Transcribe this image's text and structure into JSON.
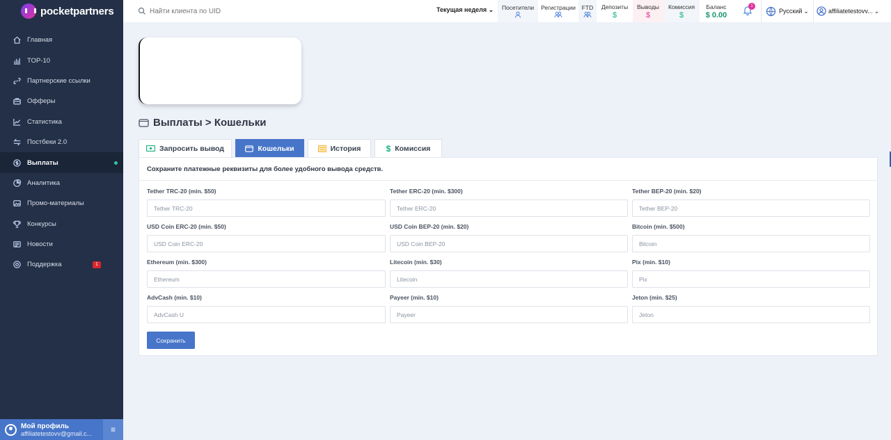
{
  "brand": "pocketpartners",
  "sidebar": {
    "items": [
      {
        "label": "Главная",
        "icon": "home-icon"
      },
      {
        "label": "TOP-10",
        "icon": "bar-chart-icon"
      },
      {
        "label": "Партнерские ссылки",
        "icon": "link-icon"
      },
      {
        "label": "Офферы",
        "icon": "briefcase-icon"
      },
      {
        "label": "Статистика",
        "icon": "line-chart-icon"
      },
      {
        "label": "Постбеки 2.0",
        "icon": "postback-icon"
      },
      {
        "label": "Выплаты",
        "icon": "dollar-circle-icon",
        "active": true
      },
      {
        "label": "Аналитика",
        "icon": "pie-chart-icon"
      },
      {
        "label": "Промо-материалы",
        "icon": "image-icon"
      },
      {
        "label": "Конкурсы",
        "icon": "trophy-icon"
      },
      {
        "label": "Новости",
        "icon": "news-icon"
      },
      {
        "label": "Поддержка",
        "icon": "support-icon",
        "badge": "1"
      }
    ]
  },
  "profile": {
    "title": "Мой профиль",
    "email": "affiliatetestovv@gmail.c..."
  },
  "topbar": {
    "search_placeholder": "Найти клиента по UID",
    "period": "Текущая неделя",
    "stats": {
      "visitors": "Посетители",
      "registrations": "Регистрации",
      "ftd": "FTD",
      "deposits": "Депозиты",
      "deposits_value": "$",
      "withdrawals": "Выводы",
      "withdrawals_value": "$",
      "commission": "Комиссия",
      "commission_value": "$",
      "balance": "Баланс",
      "balance_value": "$ 0.00"
    },
    "notifications": "1",
    "language": "Русский",
    "user": "affiliatetestovv..."
  },
  "page": {
    "title": "Выплаты > Кошельки",
    "tabs": [
      {
        "label": "Запросить вывод"
      },
      {
        "label": "Кошельки"
      },
      {
        "label": "История"
      },
      {
        "label": "Комиссия"
      }
    ],
    "description": "Сохраните платежные реквизиты для более удобного вывода средств.",
    "fields": [
      {
        "label": "Tether TRC-20 (min. $50)",
        "placeholder": "Tether TRC-20"
      },
      {
        "label": "Tether ERC-20 (min. $300)",
        "placeholder": "Tether ERC-20"
      },
      {
        "label": "Tether BEP-20 (min. $20)",
        "placeholder": "Tether BEP-20"
      },
      {
        "label": "USD Coin ERC-20 (min. $50)",
        "placeholder": "USD Coin ERC-20"
      },
      {
        "label": "USD Coin BEP-20 (min. $20)",
        "placeholder": "USD Coin BEP-20"
      },
      {
        "label": "Bitcoin (min. $500)",
        "placeholder": "Bitcoin"
      },
      {
        "label": "Ethereum (min. $300)",
        "placeholder": "Ethereum"
      },
      {
        "label": "Litecoin (min. $30)",
        "placeholder": "Litecoin"
      },
      {
        "label": "Pix (min. $10)",
        "placeholder": "Pix"
      },
      {
        "label": "AdvCash (min. $10)",
        "placeholder": "AdvCash U"
      },
      {
        "label": "Payeer (min. $10)",
        "placeholder": "Payeer"
      },
      {
        "label": "Jeton (min. $25)",
        "placeholder": "Jeton"
      }
    ],
    "save_label": "Сохранить"
  },
  "colors": {
    "accent": "#4775c9",
    "sidebar": "#233047",
    "success": "#18966d",
    "danger": "#e0339a"
  }
}
